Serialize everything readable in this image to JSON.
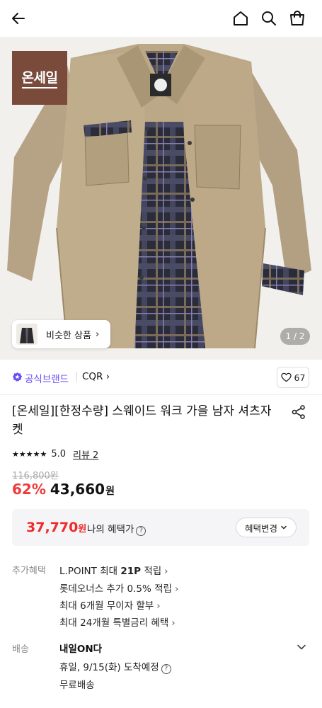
{
  "header": {
    "back": "back-arrow-icon",
    "home": "home-icon",
    "search": "search-icon",
    "bag": "shopping-bag-icon"
  },
  "gallery": {
    "brand_badge": "온세일",
    "similar_label": "비슷한 상품",
    "page_indicator": "1 / 2"
  },
  "brand": {
    "official_label": "공식브랜드",
    "name": "CQR",
    "name_chevron": "›",
    "like_count": "67"
  },
  "product": {
    "title": "[온세일][한정수량] 스웨이드 워크 가을 남자 셔츠자켓",
    "rating": "5.0",
    "rating_stars": 5,
    "review_link": "리뷰 2",
    "original_price": "116,800원",
    "discount": "62%",
    "price": "43,660",
    "price_unit": "원"
  },
  "benefit": {
    "price": "37,770",
    "price_unit": "원",
    "label": "나의 혜택가",
    "change_button": "혜택변경"
  },
  "extra": {
    "label": "추가혜택",
    "items": [
      {
        "pre": "L.POINT 최대 ",
        "bold": "21P",
        "post": " 적립"
      },
      {
        "pre": "롯데오너스 추가 0.5% 적립",
        "bold": "",
        "post": ""
      },
      {
        "pre": "최대 6개월 무이자 할부",
        "bold": "",
        "post": ""
      },
      {
        "pre": "최대 24개월 특별금리 혜택",
        "bold": "",
        "post": ""
      }
    ]
  },
  "shipping": {
    "label": "배송",
    "main": "내일ON다",
    "date": "휴일, 9/15(화) 도착예정",
    "free": "무료배송"
  },
  "colors": {
    "accent_purple": "#6a4cf5",
    "discount_red": "#ee3a3a",
    "brand_badge": "#7a4a3a"
  }
}
